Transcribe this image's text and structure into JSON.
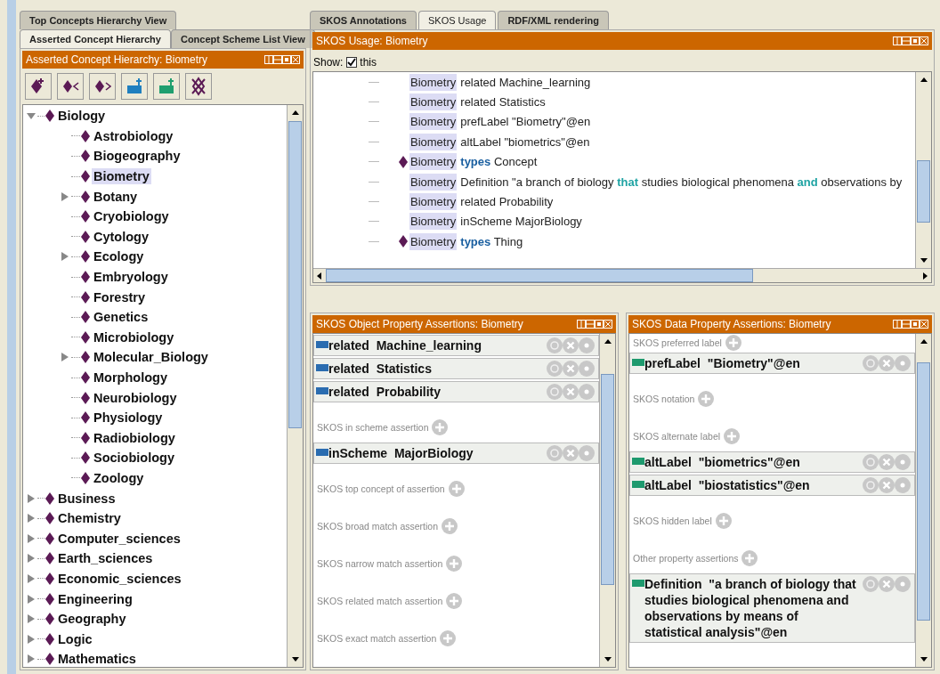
{
  "left": {
    "tab_rows": [
      [
        {
          "label": "Top Concepts Hierarchy View",
          "selected": false
        }
      ],
      [
        {
          "label": "Asserted Concept Hierarchy",
          "selected": true
        },
        {
          "label": "Concept Scheme List View",
          "selected": false
        }
      ]
    ],
    "view_title": "Asserted Concept Hierarchy: Biometry",
    "toolbar": [
      {
        "kind": "add-sub"
      },
      {
        "kind": "add-sibling-before"
      },
      {
        "kind": "add-sibling-after"
      },
      {
        "kind": "add-scheme"
      },
      {
        "kind": "add-top"
      },
      {
        "kind": "delete"
      }
    ],
    "tree": [
      {
        "label": "Biology",
        "expanded": true,
        "selected": false,
        "children": [
          {
            "label": "Astrobiology",
            "selected": false
          },
          {
            "label": "Biogeography",
            "selected": false
          },
          {
            "label": "Biometry",
            "selected": true
          },
          {
            "label": "Botany",
            "expanded": false,
            "selected": false
          },
          {
            "label": "Cryobiology",
            "selected": false
          },
          {
            "label": "Cytology",
            "selected": false
          },
          {
            "label": "Ecology",
            "expanded": false,
            "selected": false
          },
          {
            "label": "Embryology",
            "selected": false
          },
          {
            "label": "Forestry",
            "selected": false
          },
          {
            "label": "Genetics",
            "selected": false
          },
          {
            "label": "Microbiology",
            "selected": false
          },
          {
            "label": "Molecular_Biology",
            "expanded": false,
            "selected": false
          },
          {
            "label": "Morphology",
            "selected": false
          },
          {
            "label": "Neurobiology",
            "selected": false
          },
          {
            "label": "Physiology",
            "selected": false
          },
          {
            "label": "Radiobiology",
            "selected": false
          },
          {
            "label": "Sociobiology",
            "selected": false
          },
          {
            "label": "Zoology",
            "selected": false
          }
        ]
      },
      {
        "label": "Business",
        "expanded": false,
        "selected": false
      },
      {
        "label": "Chemistry",
        "expanded": false,
        "selected": false
      },
      {
        "label": "Computer_sciences",
        "expanded": false,
        "selected": false
      },
      {
        "label": "Earth_sciences",
        "expanded": false,
        "selected": false
      },
      {
        "label": "Economic_sciences",
        "expanded": false,
        "selected": false
      },
      {
        "label": "Engineering",
        "expanded": false,
        "selected": false
      },
      {
        "label": "Geography",
        "expanded": false,
        "selected": false
      },
      {
        "label": "Logic",
        "expanded": false,
        "selected": false
      },
      {
        "label": "Mathematics",
        "expanded": false,
        "selected": false
      }
    ]
  },
  "right": {
    "tabs": [
      {
        "label": "SKOS Annotations",
        "selected": false
      },
      {
        "label": "SKOS Usage",
        "selected": true
      },
      {
        "label": "RDF/XML rendering",
        "selected": false
      }
    ],
    "usage": {
      "title": "SKOS Usage: Biometry",
      "show_label": "Show:",
      "show_checkbox": {
        "label": "this",
        "checked": true
      },
      "rows": [
        {
          "kind": "plain",
          "subject": "Biometry",
          "text": "related Machine_learning"
        },
        {
          "kind": "plain",
          "subject": "Biometry",
          "text": "related Statistics"
        },
        {
          "kind": "plain",
          "subject": "Biometry",
          "text": "prefLabel \"Biometry\"@en"
        },
        {
          "kind": "plain",
          "subject": "Biometry",
          "text": "altLabel \"biometrics\"@en"
        },
        {
          "kind": "type",
          "subject": "Biometry",
          "text": "**types** Concept"
        },
        {
          "kind": "annotation",
          "subject": "Biometry",
          "text": "Definition \"a branch of biology **that** studies biological phenomena **and** observations by"
        },
        {
          "kind": "plain",
          "subject": "Biometry",
          "text": "related Probability"
        },
        {
          "kind": "plain",
          "subject": "Biometry",
          "text": "inScheme MajorBiology"
        },
        {
          "kind": "type",
          "subject": "Biometry",
          "text": "**types** Thing"
        }
      ]
    },
    "panels": [
      {
        "kind": "object",
        "title": "SKOS Object Property Assertions: Biometry",
        "items": [
          {
            "kind": "assertion",
            "text": "related  Machine_learning"
          },
          {
            "kind": "assertion",
            "text": "related  Statistics"
          },
          {
            "kind": "assertion",
            "text": "related  Probability"
          },
          {
            "kind": "header",
            "label": "SKOS in scheme assertion"
          },
          {
            "kind": "assertion",
            "text": "inScheme  MajorBiology"
          },
          {
            "kind": "header",
            "label": "SKOS top concept of assertion"
          },
          {
            "kind": "header",
            "label": "SKOS broad match assertion"
          },
          {
            "kind": "header",
            "label": "SKOS narrow match assertion"
          },
          {
            "kind": "header",
            "label": "SKOS related match assertion"
          },
          {
            "kind": "header",
            "label": "SKOS exact match assertion"
          }
        ]
      },
      {
        "kind": "data",
        "title": "SKOS Data Property Assertions: Biometry",
        "items": [
          {
            "kind": "header",
            "label": "SKOS preferred label"
          },
          {
            "kind": "assertion",
            "text": "prefLabel  \"Biometry\"@en"
          },
          {
            "kind": "header",
            "label": "SKOS notation"
          },
          {
            "kind": "header",
            "label": "SKOS alternate label"
          },
          {
            "kind": "assertion",
            "text": "altLabel  \"biometrics\"@en"
          },
          {
            "kind": "assertion",
            "text": "altLabel  \"biostatistics\"@en"
          },
          {
            "kind": "header",
            "label": "SKOS hidden label"
          },
          {
            "kind": "header",
            "label": "Other property assertions"
          },
          {
            "kind": "assertion",
            "text": "Definition  \"a branch of biology that studies biological phenomena and observations by means of statistical analysis\"@en"
          }
        ]
      }
    ]
  }
}
